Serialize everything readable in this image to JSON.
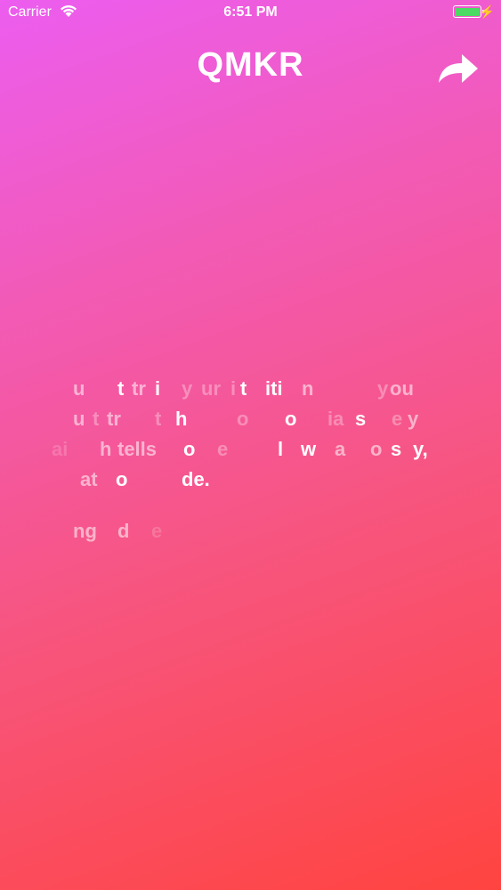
{
  "status_bar": {
    "carrier": "Carrier",
    "time": "6:51 PM",
    "charging_icon": "bolt-icon"
  },
  "header": {
    "logo": "QMKR",
    "share_icon": "share-arrow-icon"
  },
  "quote": {
    "line1": [
      {
        "t": "u",
        "o": "md"
      },
      {
        "t": "t",
        "o": "hi"
      },
      {
        "t": "tr",
        "o": "md"
      },
      {
        "t": "i",
        "o": "hi"
      },
      {
        "t": "y",
        "o": "lo"
      },
      {
        "t": "ur",
        "o": "lo"
      },
      {
        "t": "i",
        "o": "lo"
      },
      {
        "t": "t",
        "o": "hi"
      },
      {
        "t": "iti",
        "o": "hi"
      },
      {
        "t": "n",
        "o": "md"
      },
      {
        "t": "y",
        "o": "lo"
      },
      {
        "t": "ou",
        "o": "md"
      }
    ],
    "line2": [
      {
        "t": "u",
        "o": "md"
      },
      {
        "t": "t",
        "o": "lo"
      },
      {
        "t": "tr",
        "o": "md"
      },
      {
        "t": "t",
        "o": "lo"
      },
      {
        "t": "h",
        "o": "hi"
      },
      {
        "t": "o",
        "o": "lo"
      },
      {
        "t": "o",
        "o": "hi"
      },
      {
        "t": "ia",
        "o": "lo"
      },
      {
        "t": "s",
        "o": "hi"
      },
      {
        "t": "e",
        "o": "lo"
      },
      {
        "t": "y",
        "o": "md"
      }
    ],
    "line3": [
      {
        "t": "ai",
        "o": "xl"
      },
      {
        "t": "h",
        "o": "md"
      },
      {
        "t": "tells",
        "o": "md"
      },
      {
        "t": "o",
        "o": "hi"
      },
      {
        "t": "e",
        "o": "lo"
      },
      {
        "t": "l",
        "o": "hi"
      },
      {
        "t": "w",
        "o": "hi"
      },
      {
        "t": "a",
        "o": "md"
      },
      {
        "t": "o",
        "o": "md"
      },
      {
        "t": "s",
        "o": "hi"
      },
      {
        "t": "y,",
        "o": "hi"
      }
    ],
    "line4": [
      {
        "t": "at",
        "o": "md"
      },
      {
        "t": "o",
        "o": "hi"
      },
      {
        "t": "de.",
        "o": "hi"
      }
    ],
    "attribution": [
      {
        "t": "ng",
        "o": "md"
      },
      {
        "t": "d",
        "o": "md"
      },
      {
        "t": "e",
        "o": "xl"
      }
    ]
  }
}
